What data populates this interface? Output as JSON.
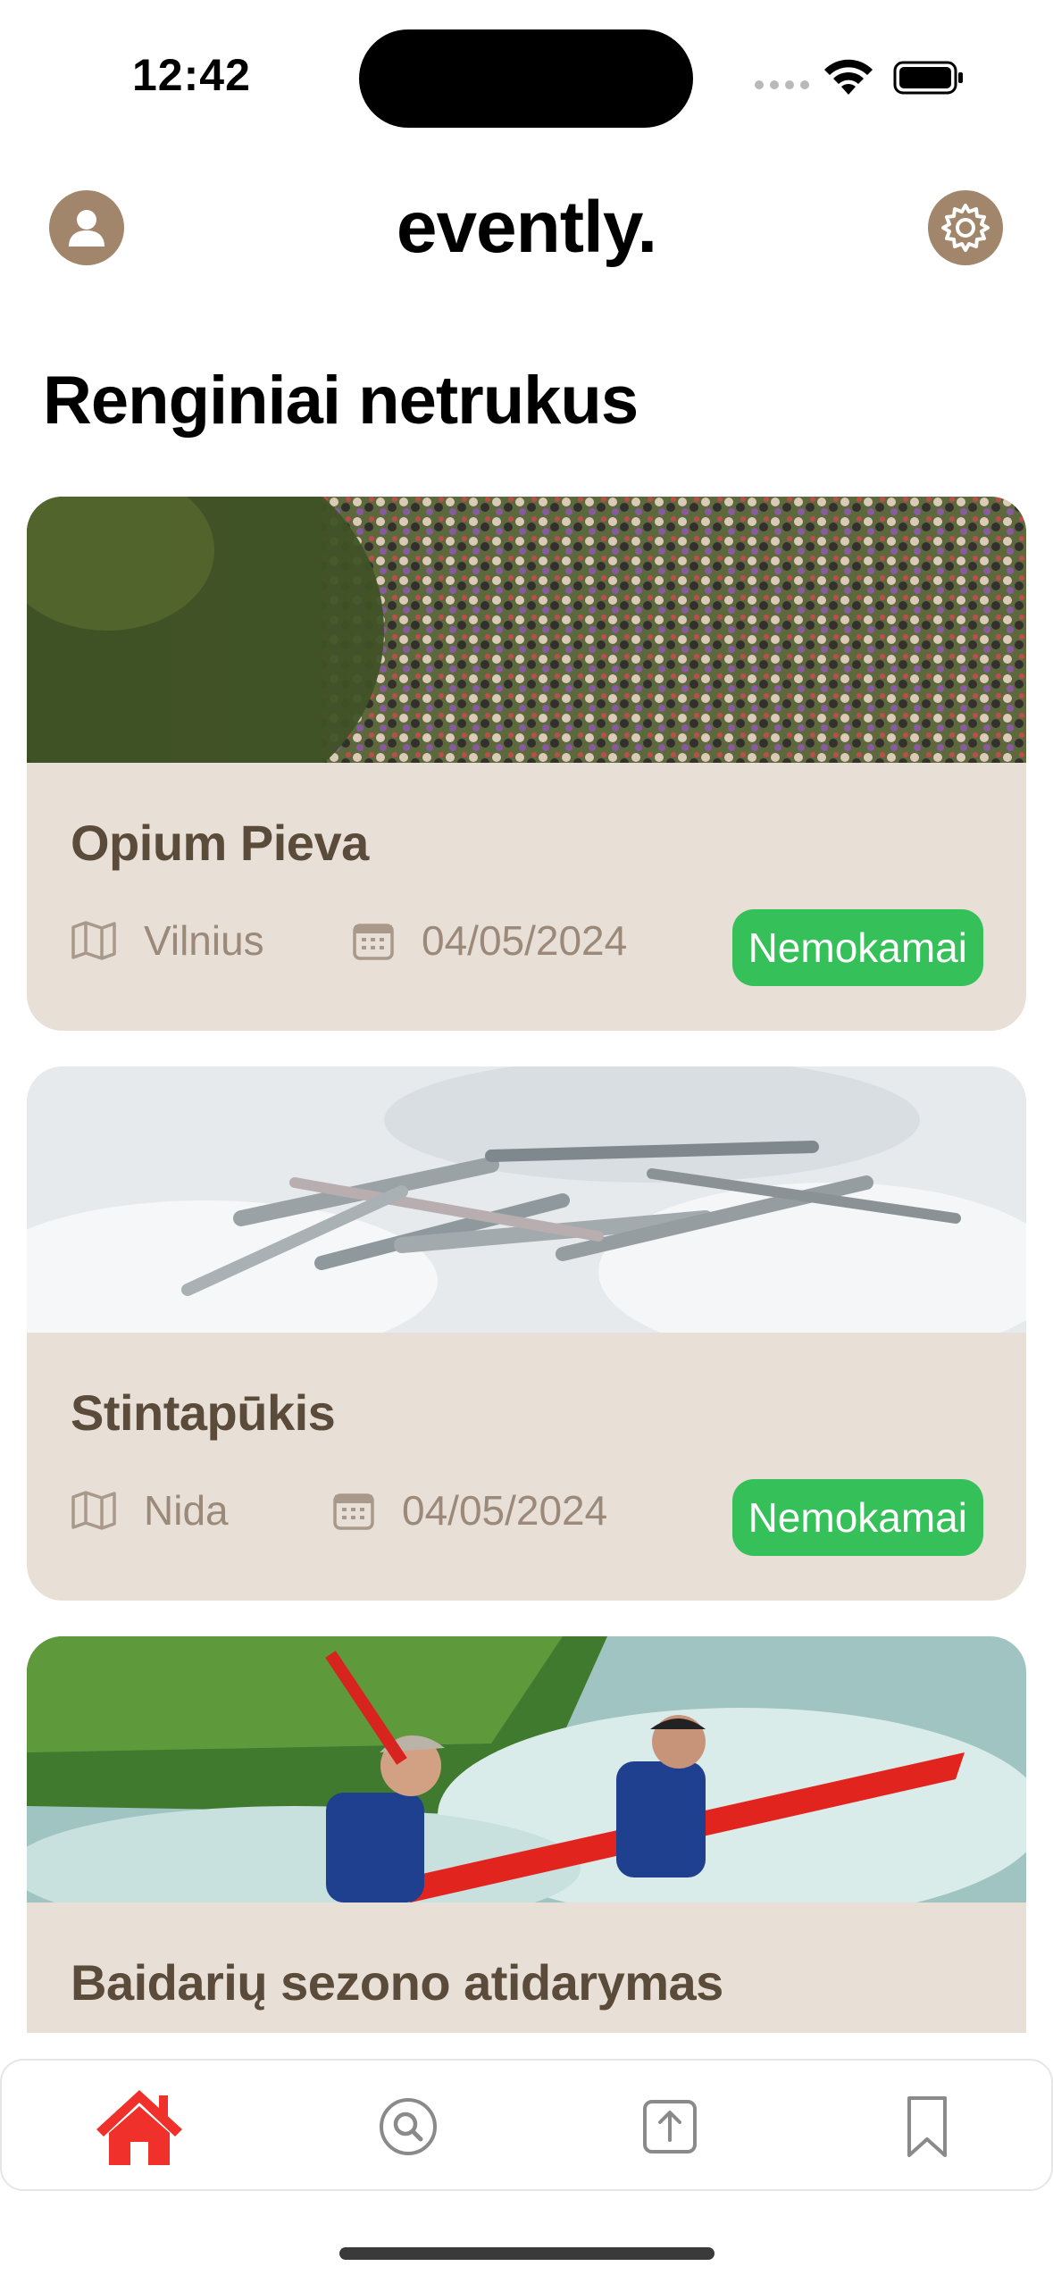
{
  "status": {
    "time": "12:42"
  },
  "header": {
    "app_title": "evently."
  },
  "section": {
    "title": "Renginiai netrukus"
  },
  "events": [
    {
      "title": "Opium Pieva",
      "location": "Vilnius",
      "date": "04/05/2024",
      "price": "Nemokamai"
    },
    {
      "title": "Stintapūkis",
      "location": "Nida",
      "date": "04/05/2024",
      "price": "Nemokamai"
    },
    {
      "title": "Baidarių sezono atidarymas"
    }
  ],
  "tabs": [
    {
      "icon": "home-icon",
      "active": true
    },
    {
      "icon": "search-icon",
      "active": false
    },
    {
      "icon": "upload-icon",
      "active": false
    },
    {
      "icon": "bookmark-icon",
      "active": false
    }
  ],
  "colors": {
    "accent": "#a2866b",
    "card_bg": "#e8dfd6",
    "card_title": "#5b4b3b",
    "meta_text": "#9b8a7a",
    "badge": "#35c05a",
    "active_tab": "#f0302a",
    "inactive_tab": "#8a8a8a"
  }
}
